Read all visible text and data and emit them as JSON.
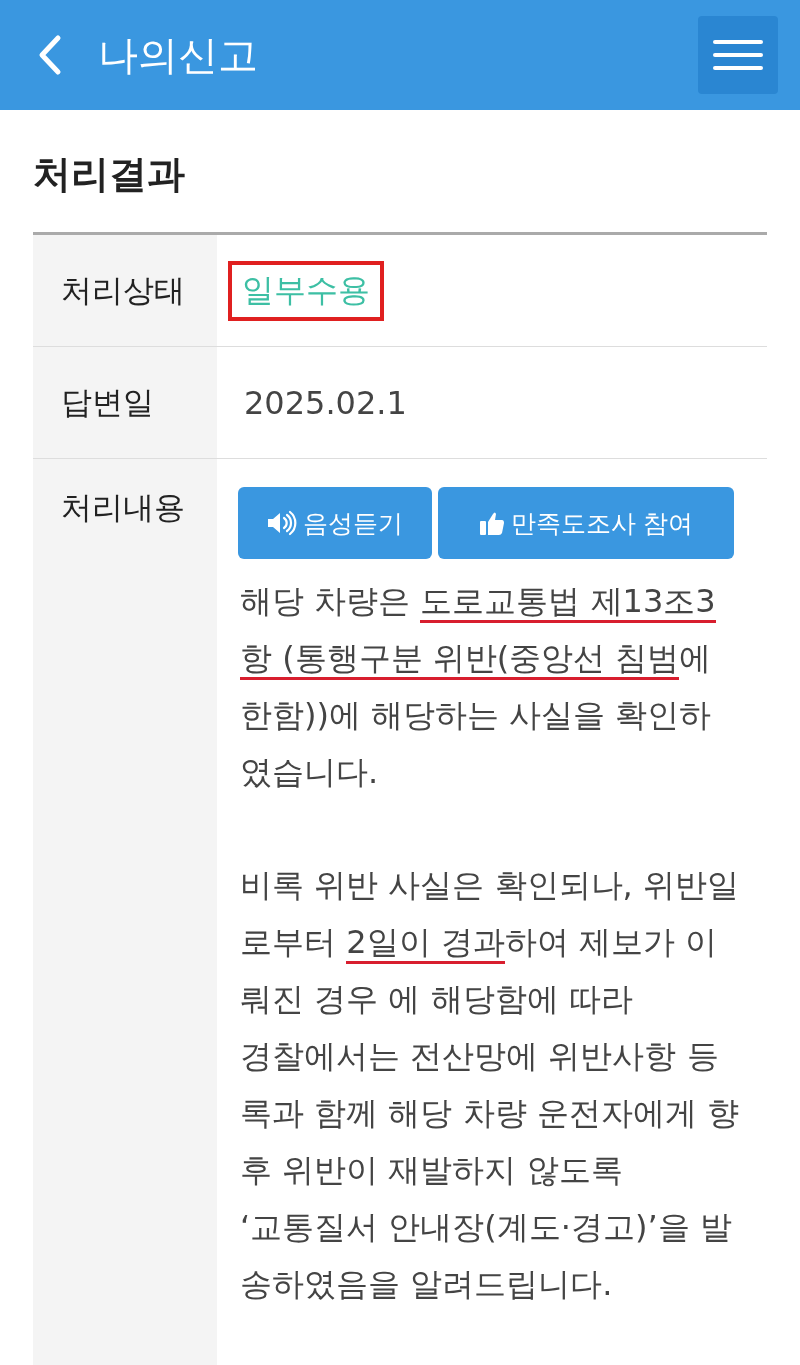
{
  "header": {
    "title": "나의신고"
  },
  "section_title": "처리결과",
  "rows": [
    {
      "kind": "status",
      "label": "처리상태",
      "value": "일부수용",
      "highlighted": true
    },
    {
      "kind": "text",
      "label": "답변일",
      "value": "2025.02.1"
    },
    {
      "kind": "content",
      "label": "처리내용",
      "buttons": [
        {
          "kind": "listen",
          "label": "음성듣기"
        },
        {
          "kind": "survey",
          "label": "만족도조사 참여"
        }
      ],
      "paragraphs": [
        {
          "lines": [
            [
              {
                "text": "해당 차량은 ",
                "underlined": false
              },
              {
                "text": "도로교통법 제13조3",
                "underlined": true
              }
            ],
            [
              {
                "text": "항 (통행구분 위반(중앙선 침범",
                "underlined": true
              },
              {
                "text": "에",
                "underlined": false
              }
            ],
            [
              {
                "text": "한함))에 해당하는 사실을 확인하",
                "underlined": false
              }
            ],
            [
              {
                "text": "였습니다.",
                "underlined": false
              }
            ]
          ]
        },
        {
          "lines": [
            [
              {
                "text": "비록 위반 사실은 확인되나, 위반일",
                "underlined": false
              }
            ],
            [
              {
                "text": "로부터 ",
                "underlined": false
              },
              {
                "text": "2일이 경과",
                "underlined": true
              },
              {
                "text": "하여 제보가 이",
                "underlined": false
              }
            ],
            [
              {
                "text": "뤄진 경우 에 해당함에 따라",
                "underlined": false
              }
            ],
            [
              {
                "text": "경찰에서는 전산망에 위반사항 등",
                "underlined": false
              }
            ],
            [
              {
                "text": "록과 함께 해당 차량 운전자에게 향",
                "underlined": false
              }
            ],
            [
              {
                "text": "후 위반이 재발하지 않도록",
                "underlined": false
              }
            ],
            [
              {
                "text": "‘교통질서 안내장(계도·경고)’을 발",
                "underlined": false
              }
            ],
            [
              {
                "text": "송하였음을 알려드립니다.",
                "underlined": false
              }
            ]
          ]
        }
      ]
    }
  ]
}
